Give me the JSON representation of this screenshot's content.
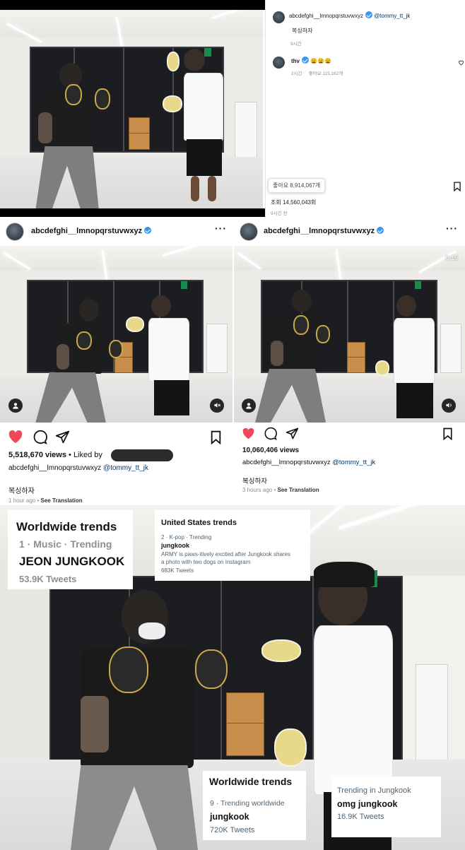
{
  "panel1": {
    "post_user": "abcdefghi__lmnopqrstuvwxyz",
    "mention": "@tommy_tt_jk",
    "caption": "복싱하자",
    "caption_time": "9시간",
    "comment_user": "thv",
    "comment_text": "😩😩😩",
    "comment_time": "2시간",
    "comment_likes": "좋아요 115,162개",
    "likes_tooltip": "좋아요 8,914,067개",
    "views": "조회 14,560,043회",
    "post_time": "9시간 전"
  },
  "panel2": {
    "username": "abcdefghi__lmnopqrstuvwxyz",
    "views": "5,518,670 views",
    "liked_by": "• Liked by",
    "caption_user": "abcdefghi__lmnopqrstuvwxyz",
    "mention": "@tommy_tt_jk",
    "caption": "복싱하자",
    "time": "1 hour ago",
    "translate": "See Translation"
  },
  "panel3": {
    "username": "abcdefghi__lmnopqrstuvwxyz",
    "timer": "0:15",
    "views": "10,060,406 views",
    "caption_user": "abcdefghi__lmnopqrstuvwxyz",
    "mention": "@tommy_tt_jk",
    "caption": "복싱하자",
    "time": "3 hours ago",
    "translate": "See Translation"
  },
  "trends": {
    "worldwide1": {
      "title": "Worldwide trends",
      "sub": "1 · Music · Trending",
      "name": "JEON JUNGKOOK",
      "count": "53.9K Tweets"
    },
    "us": {
      "title": "United States trends",
      "sub": "2 · K-pop · Trending",
      "name": "jungkook",
      "desc1": "ARMY is paws-itively excited after Jungkook shares",
      "desc2": "a photo with two dogs on Instagram",
      "count": "683K Tweets"
    },
    "worldwide2": {
      "title": "Worldwide trends",
      "sub": "9 · Trending worldwide",
      "name": "jungkook",
      "count": "720K Tweets"
    },
    "jk": {
      "sub": "Trending in Jungkook",
      "name": "omg jungkook",
      "count": "16.9K Tweets"
    }
  },
  "colors": {
    "heart": "#ed4956",
    "verified": "#3897f0",
    "link": "#00376b",
    "muted": "#8e8e8e"
  },
  "icons": [
    "heart-icon",
    "comment-icon",
    "share-icon",
    "bookmark-icon",
    "mute-icon",
    "sound-icon",
    "user-tag-icon",
    "more-icon",
    "verified-icon"
  ]
}
